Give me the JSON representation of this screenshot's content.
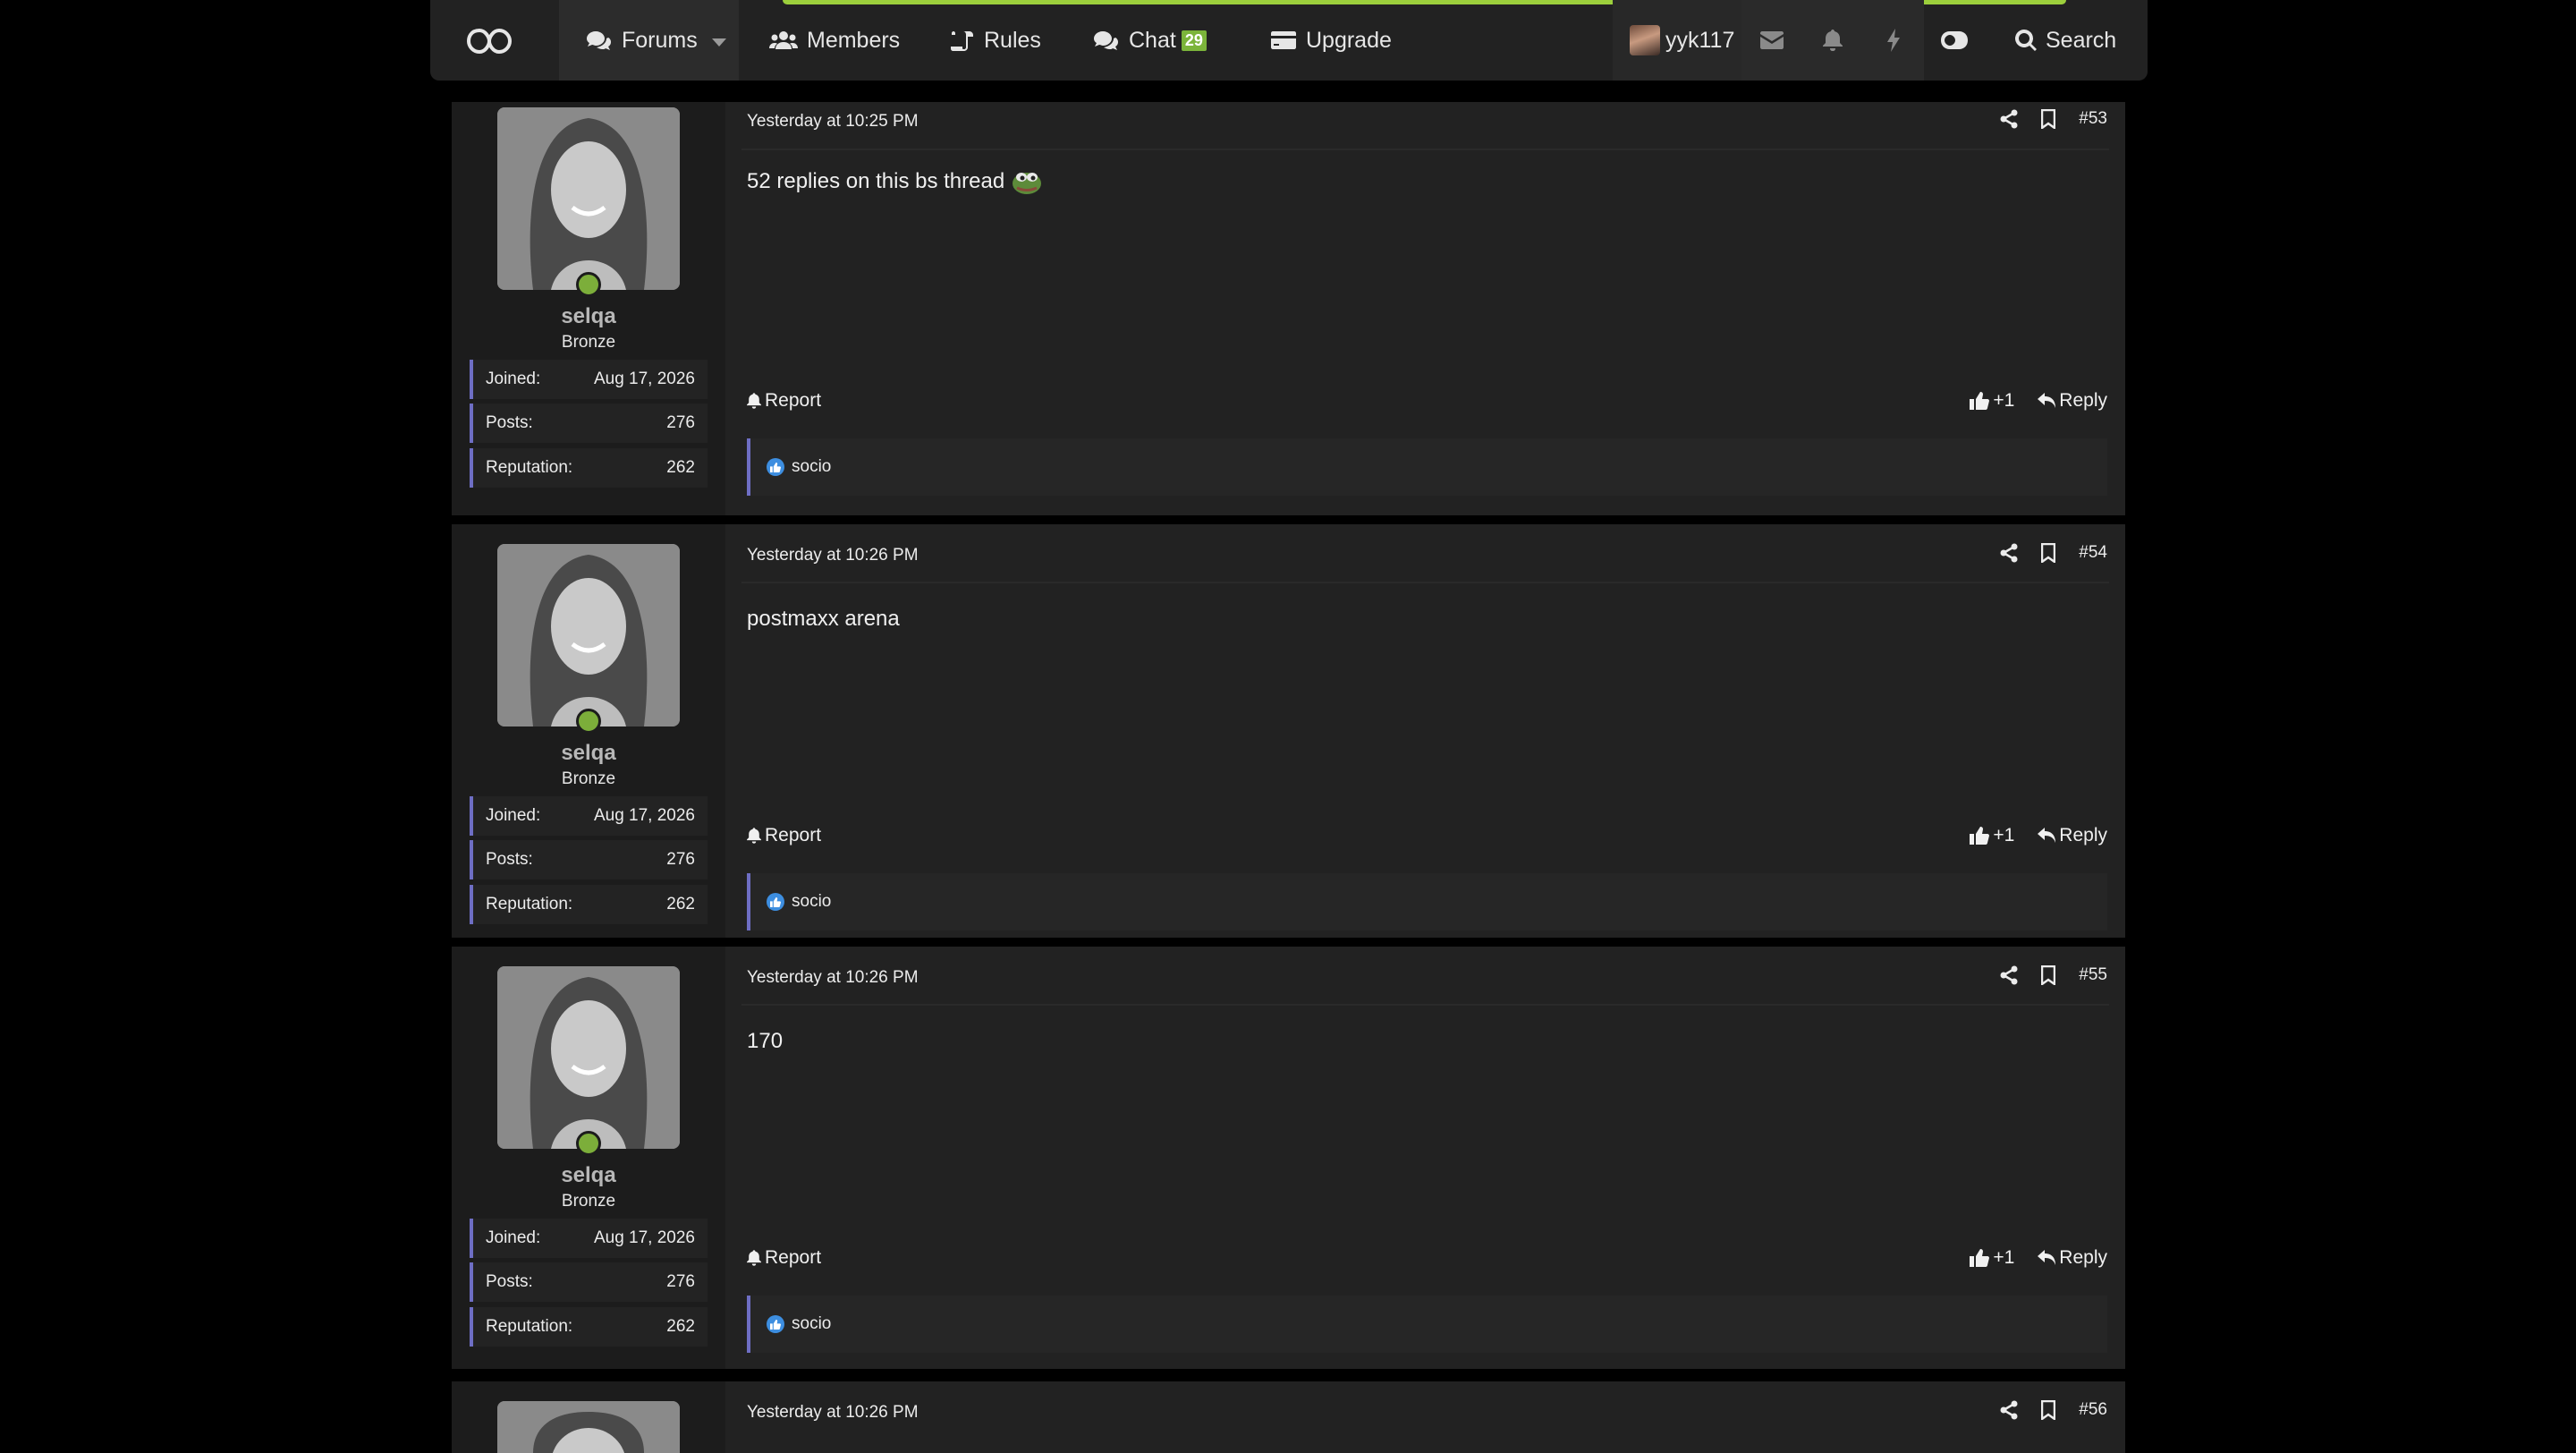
{
  "nav": {
    "forums": "Forums",
    "members": "Members",
    "rules": "Rules",
    "chat": "Chat",
    "chat_badge": "29",
    "upgrade": "Upgrade",
    "username": "yyk117",
    "search": "Search"
  },
  "colors": {
    "accent_green": "#7cae3a",
    "accent_stripe": "#9ccf3c",
    "quote_border": "#6e6ec4"
  },
  "posts": [
    {
      "author": "selqa",
      "rank": "Bronze",
      "joined_label": "Joined:",
      "joined": "Aug 17, 2026",
      "posts_label": "Posts:",
      "posts": "276",
      "rep_label": "Reputation:",
      "reputation": "262",
      "date": "Yesterday at 10:25 PM",
      "number": "#53",
      "body": "52 replies on this bs thread",
      "report": "Report",
      "plusone": "+1",
      "reply": "Reply",
      "reaction_user": "socio"
    },
    {
      "author": "selqa",
      "rank": "Bronze",
      "joined_label": "Joined:",
      "joined": "Aug 17, 2026",
      "posts_label": "Posts:",
      "posts": "276",
      "rep_label": "Reputation:",
      "reputation": "262",
      "date": "Yesterday at 10:26 PM",
      "number": "#54",
      "body": "postmaxx arena",
      "report": "Report",
      "plusone": "+1",
      "reply": "Reply",
      "reaction_user": "socio"
    },
    {
      "author": "selqa",
      "rank": "Bronze",
      "joined_label": "Joined:",
      "joined": "Aug 17, 2026",
      "posts_label": "Posts:",
      "posts": "276",
      "rep_label": "Reputation:",
      "reputation": "262",
      "date": "Yesterday at 10:26 PM",
      "number": "#55",
      "body": "170",
      "report": "Report",
      "plusone": "+1",
      "reply": "Reply",
      "reaction_user": "socio"
    },
    {
      "date": "Yesterday at 10:26 PM",
      "number": "#56"
    }
  ]
}
